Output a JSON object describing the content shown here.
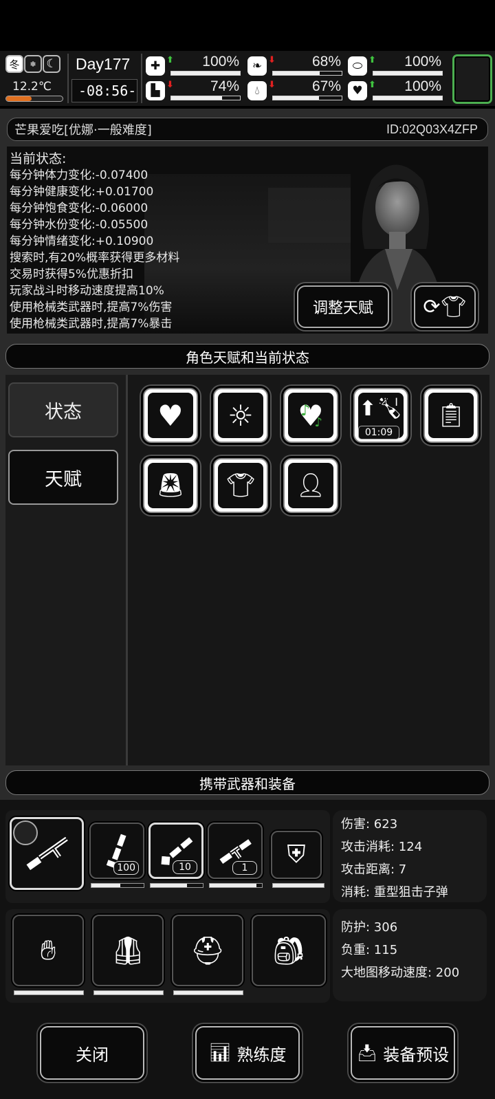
{
  "hud": {
    "season": "冬",
    "temperature": "12.2℃",
    "temperature_level": 0.45,
    "day": "Day177",
    "time": "-08:56-",
    "stats": [
      {
        "name": "health",
        "icon": "medkit-icon",
        "trend": "up",
        "value": "100%",
        "level": 1.0
      },
      {
        "name": "hunger",
        "icon": "stomach-icon",
        "trend": "down",
        "value": "68%",
        "level": 0.68
      },
      {
        "name": "mood",
        "icon": "pill-icon",
        "trend": "up",
        "value": "100%",
        "level": 1.0
      },
      {
        "name": "stamina",
        "icon": "boot-icon",
        "trend": "down",
        "value": "74%",
        "level": 0.74
      },
      {
        "name": "water",
        "icon": "water-drop-icon",
        "trend": "down",
        "value": "67%",
        "level": 0.67
      },
      {
        "name": "emotion",
        "icon": "heart-icon",
        "trend": "up",
        "value": "100%",
        "level": 1.0
      }
    ]
  },
  "character": {
    "name": "芒果爱吃[优娜·一般难度]",
    "id": "ID:02Q03X4ZFP"
  },
  "status": {
    "title": "当前状态:",
    "lines": [
      "每分钟体力变化:-0.07400",
      "每分钟健康变化:+0.01700",
      "每分钟饱食变化:-0.06000",
      "每分钟水份变化:-0.05500",
      "每分钟情绪变化:+0.10900",
      "搜索时,有20%概率获得更多材料",
      "交易时获得5%优惠折扣",
      "玩家战斗时移动速度提高10%",
      "使用枪械类武器时,提高7%伤害",
      "使用枪械类武器时,提高7%暴击"
    ],
    "adjust_button": "调整天赋"
  },
  "talent_section": {
    "title": "角色天赋和当前状态",
    "tabs": [
      "状态",
      "天赋"
    ],
    "timer": "01:09"
  },
  "equipment_section": {
    "title": "携带武器和装备",
    "weapons": [
      {
        "name": "sniper-rifle",
        "count": ""
      },
      {
        "name": "minigun",
        "count": "100"
      },
      {
        "name": "rpg",
        "count": "10"
      },
      {
        "name": "grenade-rifle",
        "count": "1"
      },
      {
        "name": "riot-shield",
        "count": ""
      }
    ],
    "weapon_info": [
      "伤害: 623",
      "攻击消耗: 124",
      "攻击距离: 7",
      "消耗: 重型狙击子弹"
    ],
    "armor_info": [
      "防护: 306",
      "负重: 115",
      "大地图移动速度: 200"
    ]
  },
  "bottom": {
    "close": "关闭",
    "proficiency": "熟练度",
    "preset": "装备预设"
  }
}
